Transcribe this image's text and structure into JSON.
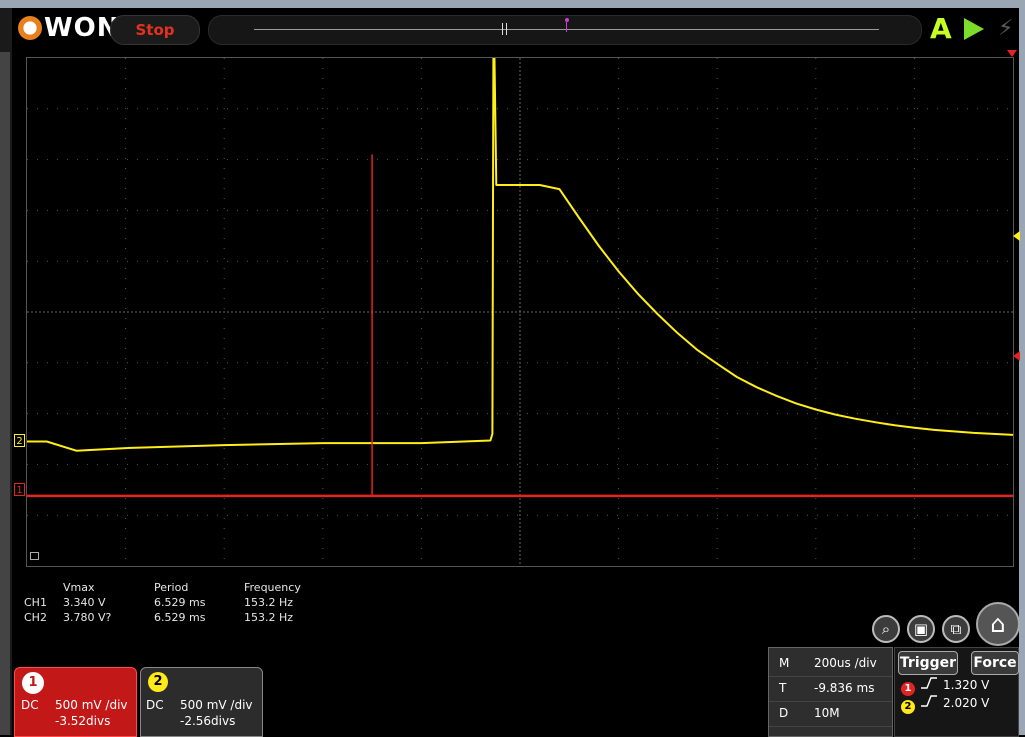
{
  "header": {
    "logo_text": "WON",
    "run_state": "Stop",
    "auto_label": "A"
  },
  "colors": {
    "ch1": "#e42323",
    "ch2": "#ffee1a",
    "stop_text": "#e4321e",
    "run_button": "#7cdd2a",
    "auto_button": "#c6ff24",
    "trigger_marker": "#d33bd3"
  },
  "icons": {
    "logo": "owon-logo-icon",
    "auto": "auto-set-icon",
    "run": "play-icon",
    "force": "lightning-icon",
    "zoom": "zoom-reset-icon",
    "save": "save-icon",
    "layout": "window-layout-icon",
    "home": "home-icon"
  },
  "screen": {
    "ch2_marker": "2",
    "ch1_marker": "1"
  },
  "chart_data": {
    "type": "line",
    "grid": true,
    "divisions": {
      "x": 10,
      "y": 10
    },
    "series": [
      {
        "name": "CH2",
        "color": "#ffee1a",
        "x": [
          0.0,
          0.2,
          0.5,
          1.0,
          2.0,
          3.0,
          4.0,
          4.7,
          4.72,
          4.73,
          4.74,
          4.76,
          5.2,
          5.4,
          5.6,
          5.8,
          6.0,
          6.2,
          6.4,
          6.6,
          6.8,
          7.0,
          7.2,
          7.4,
          7.6,
          7.8,
          8.0,
          8.2,
          8.4,
          8.6,
          8.8,
          9.0,
          9.2,
          9.4,
          9.6,
          9.8,
          10.0
        ],
        "y": [
          -2.55,
          -2.55,
          -2.73,
          -2.68,
          -2.62,
          -2.58,
          -2.58,
          -2.53,
          -2.4,
          5.1,
          5.1,
          2.5,
          2.5,
          2.42,
          1.85,
          1.3,
          0.8,
          0.35,
          -0.05,
          -0.42,
          -0.75,
          -1.02,
          -1.28,
          -1.48,
          -1.65,
          -1.8,
          -1.92,
          -2.02,
          -2.1,
          -2.17,
          -2.23,
          -2.28,
          -2.32,
          -2.35,
          -2.38,
          -2.4,
          -2.42
        ]
      },
      {
        "name": "CH1",
        "color": "#e42323",
        "x": [
          0,
          10
        ],
        "y": [
          -3.62,
          -3.62
        ]
      }
    ],
    "cursor": {
      "x": 3.5,
      "y_top": 3.1,
      "y_bottom": -3.62
    },
    "xlim": [
      0,
      10
    ],
    "ylim": [
      -5,
      5
    ]
  },
  "measurements": {
    "headers": [
      "Vmax",
      "Period",
      "Frequency"
    ],
    "rows": [
      {
        "ch": "CH1",
        "vmax": "3.340 V",
        "period": "6.529 ms",
        "frequency": "153.2 Hz"
      },
      {
        "ch": "CH2",
        "vmax": "3.780 V?",
        "period": "6.529 ms",
        "frequency": "153.2 Hz"
      }
    ]
  },
  "channels": [
    {
      "badge": "1",
      "coupling": "DC",
      "scale": "500 mV /div",
      "offset": "-3.52divs"
    },
    {
      "badge": "2",
      "coupling": "DC",
      "scale": "500 mV /div",
      "offset": "-2.56divs"
    }
  ],
  "timebase": {
    "rows": [
      {
        "key": "M",
        "value": "200us /div"
      },
      {
        "key": "T",
        "value": "-9.836 ms"
      },
      {
        "key": "D",
        "value": "10M"
      }
    ]
  },
  "trigger": {
    "trigger_label": "Trigger",
    "force_label": "Force",
    "levels": [
      {
        "ch": "1",
        "level": "1.320 V"
      },
      {
        "ch": "2",
        "level": "2.020 V"
      }
    ]
  }
}
